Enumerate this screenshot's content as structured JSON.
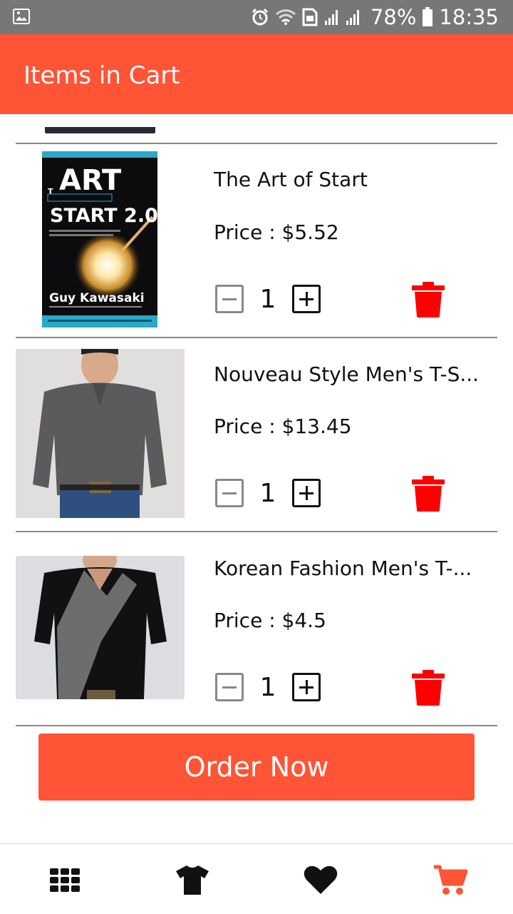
{
  "status_bar": {
    "battery": "78%",
    "time": "18:35",
    "icons": [
      "gallery-icon",
      "alarm-icon",
      "wifi-icon",
      "sim-icon",
      "signal-icon",
      "battery-icon"
    ]
  },
  "app_bar": {
    "title": "Items in Cart"
  },
  "cart": {
    "items": [
      {
        "title": "The Art of Start",
        "price": "Price : $5.52",
        "qty": "1",
        "cover": {
          "line1": "ART",
          "line2": "START 2.0",
          "author": "Guy Kawasaki"
        }
      },
      {
        "title": "Nouveau Style Men's T-S...",
        "price": "Price : $13.45",
        "qty": "1"
      },
      {
        "title": "Korean Fashion Men's T-...",
        "price": "Price : $4.5",
        "qty": "1"
      }
    ]
  },
  "actions": {
    "order_label": "Order Now"
  },
  "bottom_nav": {
    "items": [
      "grid-icon",
      "tshirt-icon",
      "heart-icon",
      "cart-icon"
    ],
    "active": "cart-icon"
  },
  "colors": {
    "accent": "#ff5436",
    "delete": "#ff0000",
    "status_bar": "#777777"
  }
}
